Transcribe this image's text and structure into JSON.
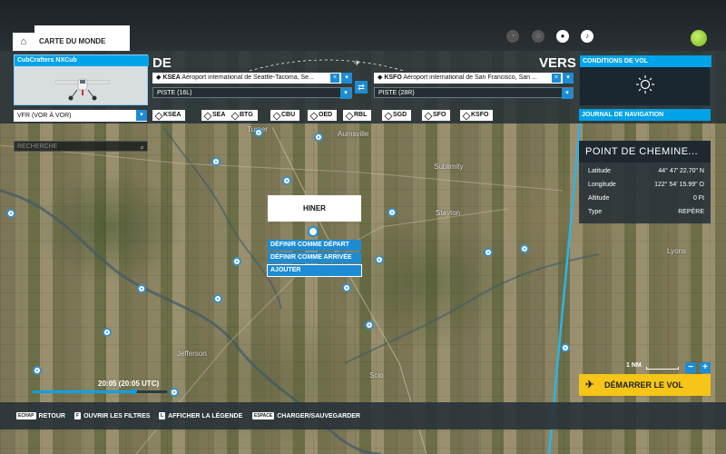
{
  "topbar": {
    "tab_label": "CARTE DU MONDE"
  },
  "aircraft": {
    "name": "CubCrafters NXCub"
  },
  "route": {
    "from_label": "DE",
    "to_label": "VERS",
    "from_code": "KSEA",
    "from_name": "Aéroport international de Seattle-Tacoma, Se...",
    "to_code": "KSFO",
    "to_name": "Aéroport international de San Francisco, San ...",
    "from_runway": "PISTE (16L)",
    "to_runway": "PISTE (28R)"
  },
  "weather": {
    "title": "CONDITIONS DE VOL"
  },
  "navlog": {
    "title": "JOURNAL DE NAVIGATION"
  },
  "nav_type": "VFR (VOR À VOR)",
  "waypoints": [
    "KSEA",
    "SEA",
    "BTG",
    "CBU",
    "OED",
    "RBL",
    "SGD",
    "SFO",
    "KSFO"
  ],
  "search": {
    "placeholder": "RECHERCHE"
  },
  "map_places": [
    "Turner",
    "Aumsville",
    "Sublimity",
    "Stayton",
    "Lyons",
    "Jefferson",
    "Scio"
  ],
  "context_menu": {
    "title": "HINER",
    "items": [
      "DÉFINIR COMME DÉPART",
      "DÉFINIR COMME ARRIVÉE",
      "AJOUTER"
    ]
  },
  "point_info": {
    "title": "POINT DE CHEMINE...",
    "rows": [
      {
        "label": "Latitude",
        "value": "44° 47' 22.70\" N"
      },
      {
        "label": "Longitude",
        "value": "122° 54' 15.99\" O"
      },
      {
        "label": "Altitude",
        "value": "0 Ft"
      },
      {
        "label": "Type",
        "value": "REPÈRE"
      }
    ]
  },
  "scale": {
    "label": "1 NM"
  },
  "zoom": {
    "minus": "−",
    "plus": "+"
  },
  "time": {
    "label": "20:05 (20:05 UTC)",
    "progress": 0.76
  },
  "start_button": "DÉMARRER LE VOL",
  "shortcuts": [
    {
      "key": "ECHAP",
      "label": "RETOUR"
    },
    {
      "key": "F",
      "label": "OUVRIR LES FILTRES"
    },
    {
      "key": "L",
      "label": "AFFICHER LA LÉGENDE"
    },
    {
      "key": "ESPACE",
      "label": "CHARGER/SAUVEGARDER"
    }
  ],
  "colors": {
    "accent": "#00a3e8",
    "start": "#f5c518",
    "route_line": "#2ab5ea"
  }
}
